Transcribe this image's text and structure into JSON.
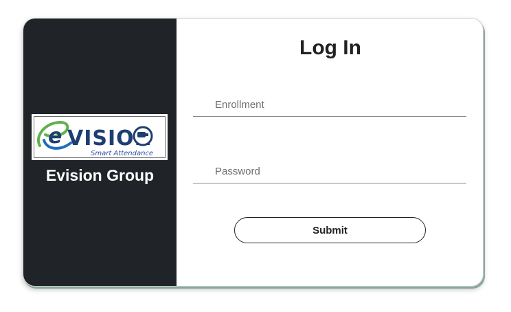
{
  "brand": {
    "logo_main": "VISION",
    "logo_initial": "e",
    "logo_tagline": "Smart Attendance",
    "group_name": "Evision Group"
  },
  "form": {
    "title": "Log In",
    "enrollment_placeholder": "Enrollment",
    "password_placeholder": "Password",
    "submit_label": "Submit"
  },
  "colors": {
    "left_panel": "#202428",
    "logo_blue": "#1d3e72",
    "logo_green": "#5fb24a",
    "tagline": "#2d4fa8"
  }
}
